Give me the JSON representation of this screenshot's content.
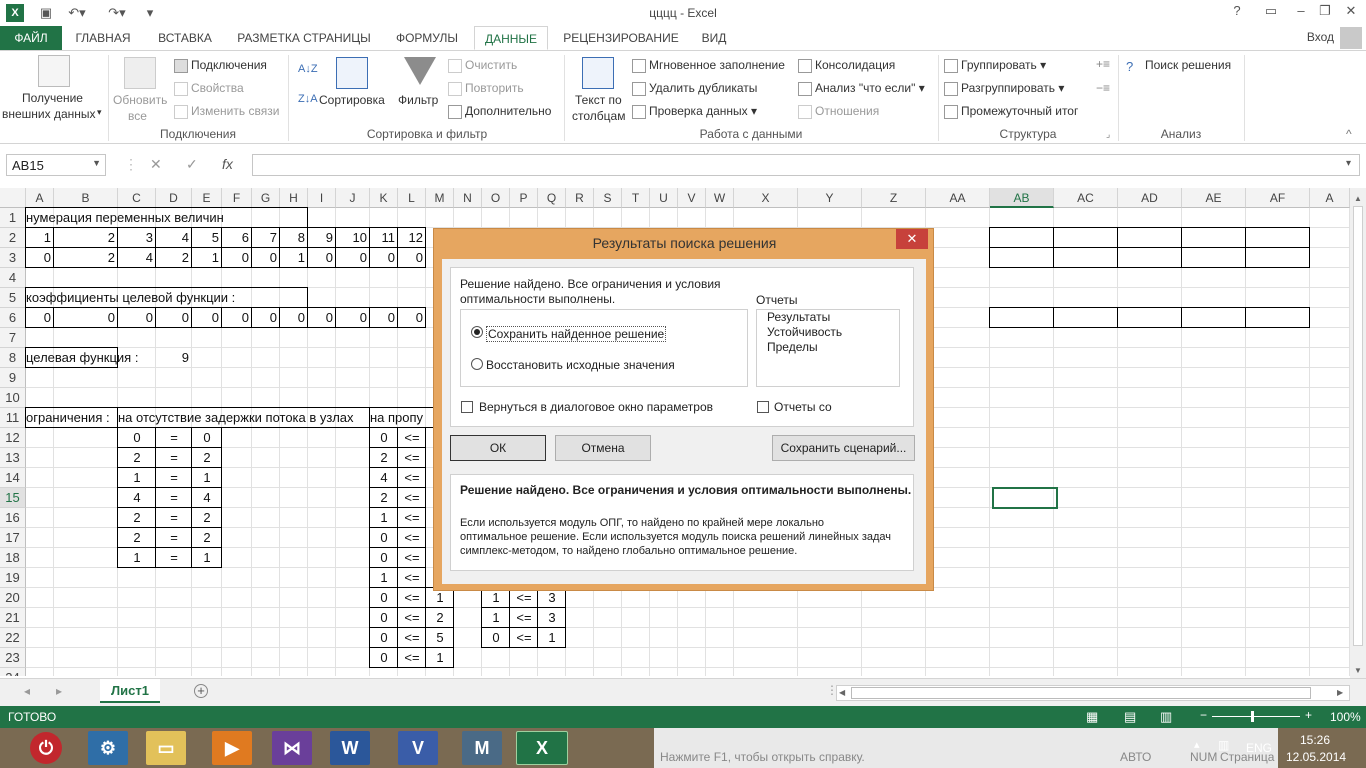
{
  "window": {
    "title": "цццц - Excel",
    "help": "?",
    "signin": "Вход"
  },
  "tabs": [
    "ФАЙЛ",
    "ГЛАВНАЯ",
    "ВСТАВКА",
    "РАЗМЕТКА СТРАНИЦЫ",
    "ФОРМУЛЫ",
    "ДАННЫЕ",
    "РЕЦЕНЗИРОВАНИЕ",
    "ВИД"
  ],
  "ribbon": {
    "get_data_1": "Получение",
    "get_data_2": "внешних данных",
    "refresh_1": "Обновить",
    "refresh_2": "все",
    "connections": "Подключения",
    "properties": "Свойства",
    "edit_links": "Изменить связи",
    "grp_connections": "Подключения",
    "sort": "Сортировка",
    "filter": "Фильтр",
    "clear": "Очистить",
    "reapply": "Повторить",
    "advanced": "Дополнительно",
    "grp_sort": "Сортировка и фильтр",
    "text_cols_1": "Текст по",
    "text_cols_2": "столбцам",
    "flash_fill": "Мгновенное заполнение",
    "remove_dup": "Удалить дубликаты",
    "validation": "Проверка данных",
    "consolidate": "Консолидация",
    "whatif": "Анализ \"что если\"",
    "relations": "Отношения",
    "grp_datatools": "Работа с данными",
    "group": "Группировать",
    "ungroup": "Разгруппировать",
    "subtotal": "Промежуточный итог",
    "grp_outline": "Структура",
    "solver": "Поиск решения",
    "grp_analysis": "Анализ"
  },
  "namebox": "AB15",
  "columns": [
    "A",
    "B",
    "C",
    "D",
    "E",
    "F",
    "G",
    "H",
    "I",
    "J",
    "K",
    "L",
    "M",
    "N",
    "O",
    "P",
    "Q",
    "R",
    "S",
    "T",
    "U",
    "V",
    "W",
    "X",
    "Y",
    "Z",
    "AA",
    "AB",
    "AC",
    "AD",
    "AE",
    "AF",
    "A"
  ],
  "rows": [
    "1",
    "2",
    "3",
    "4",
    "5",
    "6",
    "7",
    "8",
    "9",
    "10",
    "11",
    "12",
    "13",
    "14",
    "15",
    "16",
    "17",
    "18",
    "19",
    "20",
    "21",
    "22",
    "23",
    "24"
  ],
  "cells": {
    "r1": "нумерация переменных величин",
    "r2": [
      "1",
      "2",
      "3",
      "4",
      "5",
      "6",
      "7",
      "8",
      "9",
      "10",
      "11",
      "12"
    ],
    "r3": [
      "0",
      "2",
      "4",
      "2",
      "1",
      "0",
      "0",
      "1",
      "0",
      "0",
      "0",
      "0"
    ],
    "r5": "коэффициенты целевой функции :",
    "r6": [
      "0",
      "0",
      "0",
      "0",
      "0",
      "0",
      "0",
      "0",
      "0",
      "0",
      "0",
      "0"
    ],
    "r8_label": "целевая функция :",
    "r8_value": "9",
    "r11_a": "ограничения :",
    "r11_c": "на отсутствие задержки потока в узлах",
    "r11_k": "на пропу",
    "eq_left": [
      "0",
      "2",
      "1",
      "4",
      "2",
      "2",
      "1"
    ],
    "eq_sign": "=",
    "eq_right": [
      "0",
      "2",
      "1",
      "4",
      "2",
      "2",
      "1"
    ],
    "k_left": [
      "0",
      "2",
      "4",
      "2",
      "1",
      "0",
      "0",
      "1",
      "0",
      "0",
      "0",
      "0"
    ],
    "le_sign": "<=",
    "m_vals": [
      "1",
      "2",
      "5",
      "1"
    ],
    "o_vals": [
      "1",
      "1",
      "0"
    ],
    "q_vals": [
      "3",
      "3",
      "1"
    ]
  },
  "sheet": {
    "name": "Лист1",
    "add": "+"
  },
  "status": {
    "ready": "ГОТОВО",
    "zoom": "100%"
  },
  "taskbar": {
    "help_text": "Нажмите F1, чтобы открыть справку.",
    "avto": "АВТО",
    "num": "NUM",
    "page": "Страница",
    "lang": "ENG",
    "time": "15:26",
    "date": "12.05.2014"
  },
  "dialog": {
    "title": "Результаты поиска решения",
    "msg1": "Решение найдено. Все ограничения и условия",
    "msg2": "оптимальности выполнены.",
    "keep": "Сохранить найденное решение",
    "restore": "Восстановить исходные значения",
    "reports_label": "Отчеты",
    "reports": [
      "Результаты",
      "Устойчивость",
      "Пределы"
    ],
    "return_params": "Вернуться в диалоговое окно параметров",
    "outline_reports": "Отчеты со",
    "ok": "ОК",
    "cancel": "Отмена",
    "save_scenario": "Сохранить сценарий...",
    "info_bold": "Решение найдено. Все ограничения и условия оптимальности выполнены.",
    "info1": "Если используется модуль ОПГ, то найдено по крайней мере локально",
    "info2": "оптимальное решение. Если используется модуль поиска решений линейных задач",
    "info3": "симплекс-методом, то найдено глобально оптимальное решение."
  }
}
